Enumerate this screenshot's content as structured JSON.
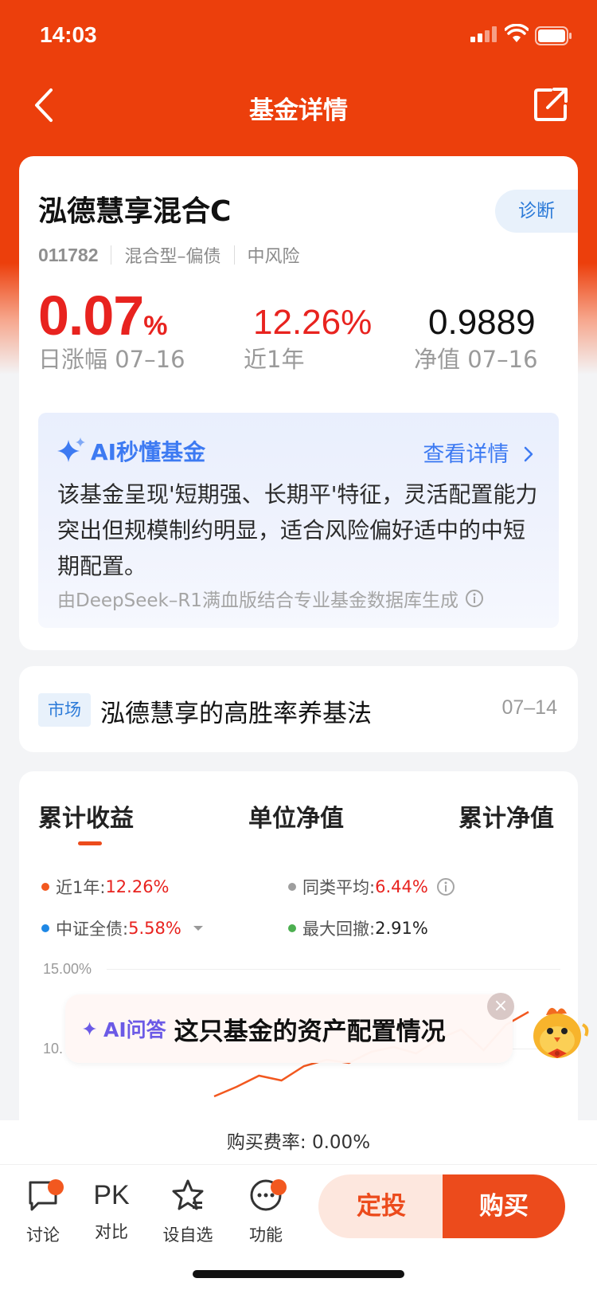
{
  "status": {
    "time": "14:03"
  },
  "nav": {
    "title": "基金详情"
  },
  "fund": {
    "name": "泓德慧享混合C",
    "diagnose": "诊断",
    "code": "011782",
    "type": "混合型–偏债",
    "risk": "中风险",
    "daily_change": "0.07",
    "daily_unit": "%",
    "daily_label": "日涨幅 07–16",
    "year_return": "12.26%",
    "year_label": "近1年",
    "nav_value": "0.9889",
    "nav_label": "净值 07–16"
  },
  "ai": {
    "title": "AI秒懂基金",
    "more": "查看详情",
    "text": "该基金呈现'短期强、长期平'特征，灵活配置能力突出但规模制约明显，适合风险偏好适中的中短期配置。",
    "footer": "由DeepSeek–R1满血版结合专业基金数据库生成"
  },
  "news": {
    "tag": "市场",
    "title": "泓德慧享的高胜率养基法",
    "date": "07–14"
  },
  "chart": {
    "tabs": [
      "累计收益",
      "单位净值",
      "累计净值"
    ],
    "legend": [
      {
        "label": "近1年:",
        "value": "12.26%",
        "color": "#f2581f"
      },
      {
        "label": "同类平均:",
        "value": "6.44%",
        "color": "#9e9e9e"
      },
      {
        "label": "中证全债:",
        "value": "5.58%",
        "color": "#1e88e5"
      },
      {
        "label": "最大回撤:",
        "value": "2.91%",
        "color": "#4caf50"
      }
    ],
    "y_top": "15.00%",
    "y_mid": "10."
  },
  "chart_data": {
    "type": "line",
    "series": [
      {
        "name": "近1年",
        "values": [
          7.0,
          7.6,
          8.3,
          8.0,
          8.9,
          9.3,
          9.1,
          9.8,
          10.1,
          9.7,
          10.6,
          11.2,
          9.9,
          11.5,
          12.3
        ]
      }
    ],
    "ylim": [
      0,
      15
    ]
  },
  "float_ai": {
    "brand": "AI问答",
    "question": "这只基金的资产配置情况",
    "close": "×"
  },
  "fee": {
    "text": "购买费率: 0.00%"
  },
  "bottom": {
    "discuss": "讨论",
    "pk_icon": "PK",
    "compare": "对比",
    "favorite": "设自选",
    "functions": "功能",
    "regular": "定投",
    "buy": "购买"
  },
  "colors": {
    "brand": "#ec3f0c",
    "rise": "#e8231f",
    "ai_blue": "#3d7af2"
  }
}
